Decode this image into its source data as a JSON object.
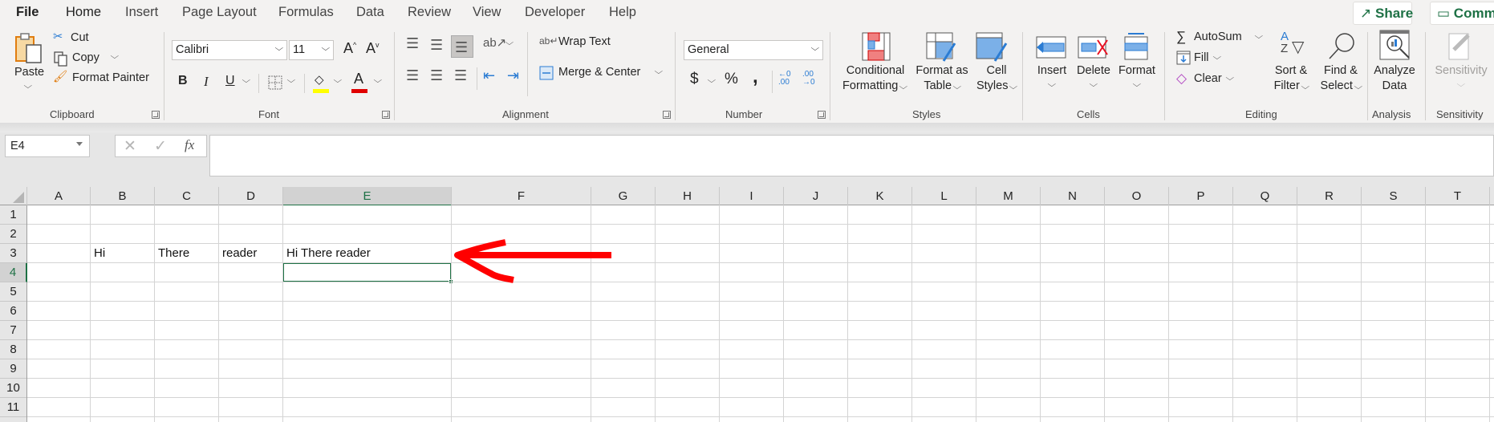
{
  "tabs": {
    "file": "File",
    "items": [
      "Home",
      "Insert",
      "Page Layout",
      "Formulas",
      "Data",
      "Review",
      "View",
      "Developer",
      "Help"
    ],
    "active": "Home"
  },
  "top_buttons": {
    "share": "Share",
    "comments": "Comm"
  },
  "ribbon": {
    "clipboard": {
      "label": "Clipboard",
      "paste": "Paste",
      "cut": "Cut",
      "copy": "Copy",
      "format_painter": "Format Painter"
    },
    "font": {
      "label": "Font",
      "font_name": "Calibri",
      "font_size": "11",
      "bold": "B",
      "italic": "I",
      "underline": "U",
      "grow": "A",
      "shrink": "A",
      "font_color_letter": "A",
      "highlight_color": "#ffff00",
      "font_color": "#e00000"
    },
    "alignment": {
      "label": "Alignment",
      "wrap_text": "Wrap Text",
      "merge_center": "Merge & Center"
    },
    "number": {
      "label": "Number",
      "format": "General",
      "currency": "$",
      "percent": "%",
      "comma": ","
    },
    "styles": {
      "label": "Styles",
      "conditional_1": "Conditional",
      "conditional_2": "Formatting",
      "format_table_1": "Format as",
      "format_table_2": "Table",
      "cell_styles_1": "Cell",
      "cell_styles_2": "Styles"
    },
    "cells": {
      "label": "Cells",
      "insert": "Insert",
      "delete": "Delete",
      "format": "Format"
    },
    "editing": {
      "label": "Editing",
      "autosum": "AutoSum",
      "fill": "Fill",
      "clear": "Clear",
      "sort_1": "Sort &",
      "sort_2": "Filter",
      "find_1": "Find &",
      "find_2": "Select"
    },
    "analysis": {
      "label": "Analysis",
      "analyze_1": "Analyze",
      "analyze_2": "Data"
    },
    "sensitivity": {
      "label": "Sensitivity",
      "button": "Sensitivity"
    }
  },
  "formula_bar": {
    "name_box": "E4",
    "fx": "fx",
    "value": ""
  },
  "sheet": {
    "columns": [
      "A",
      "B",
      "C",
      "D",
      "E",
      "F",
      "G",
      "H",
      "I",
      "J",
      "K",
      "L",
      "M",
      "N",
      "O",
      "P",
      "Q",
      "R",
      "S",
      "T"
    ],
    "rows": [
      "1",
      "2",
      "3",
      "4",
      "5",
      "6",
      "7",
      "8",
      "9",
      "10",
      "11"
    ],
    "selected_cell": "E4",
    "cells": {
      "B3": "Hi",
      "C3": "There",
      "D3": "reader",
      "E3": "Hi There reader"
    }
  },
  "annotation": {
    "type": "arrow",
    "color": "#ff0000",
    "points_to": "E3"
  },
  "colors": {
    "accent": "#1e7145"
  }
}
